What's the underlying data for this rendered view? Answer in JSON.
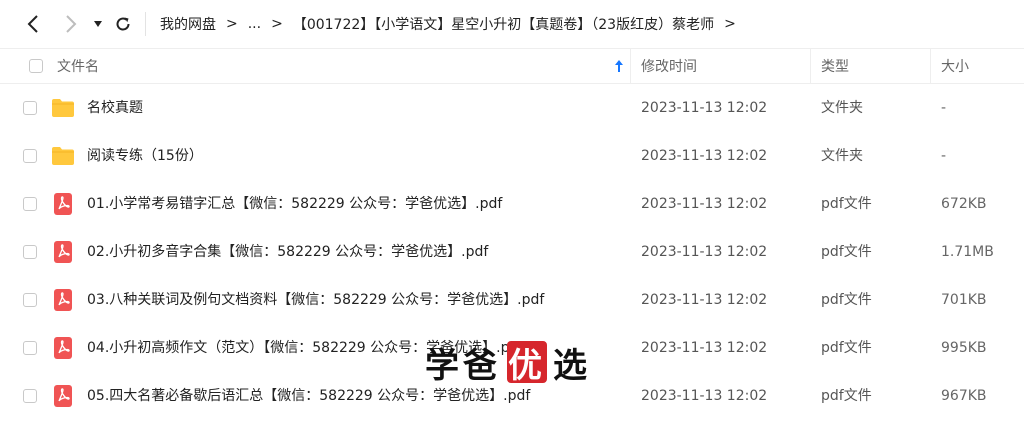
{
  "toolbar": {
    "back_icon": "chevron-left-icon",
    "forward_icon": "chevron-right-icon",
    "history_icon": "caret-down-icon",
    "refresh_icon": "refresh-icon"
  },
  "breadcrumb": {
    "items": [
      "我的网盘",
      "...",
      "【001722】【小学语文】星空小升初【真题卷】（23版红皮）蔡老师"
    ],
    "separator": ">"
  },
  "columns": {
    "name": "文件名",
    "modified": "修改时间",
    "type": "类型",
    "size": "大小"
  },
  "files": [
    {
      "name": "名校真题",
      "modified": "2023-11-13 12:02",
      "type": "文件夹",
      "size": "-",
      "icon": "folder-icon"
    },
    {
      "name": "阅读专练（15份）",
      "modified": "2023-11-13 12:02",
      "type": "文件夹",
      "size": "-",
      "icon": "folder-icon"
    },
    {
      "name": "01.小学常考易错字汇总【微信：582229 公众号：学爸优选】.pdf",
      "modified": "2023-11-13 12:02",
      "type": "pdf文件",
      "size": "672KB",
      "icon": "pdf-icon"
    },
    {
      "name": "02.小升初多音字合集【微信：582229 公众号：学爸优选】.pdf",
      "modified": "2023-11-13 12:02",
      "type": "pdf文件",
      "size": "1.71MB",
      "icon": "pdf-icon"
    },
    {
      "name": "03.八种关联词及例句文档资料【微信：582229 公众号：学爸优选】.pdf",
      "modified": "2023-11-13 12:02",
      "type": "pdf文件",
      "size": "701KB",
      "icon": "pdf-icon"
    },
    {
      "name": "04.小升初高频作文（范文）【微信：582229 公众号：学爸优选】.pdf",
      "modified": "2023-11-13 12:02",
      "type": "pdf文件",
      "size": "995KB",
      "icon": "pdf-icon"
    },
    {
      "name": "05.四大名著必备歇后语汇总【微信：582229 公众号：学爸优选】.pdf",
      "modified": "2023-11-13 12:02",
      "type": "pdf文件",
      "size": "967KB",
      "icon": "pdf-icon"
    }
  ],
  "watermark": {
    "text_before": "学爸",
    "seal_char": "优",
    "text_after": "选"
  },
  "colors": {
    "folder": "#ffc83d",
    "pdf": "#f05454",
    "sort_arrow": "#1677ff",
    "seal": "#d6262c"
  }
}
